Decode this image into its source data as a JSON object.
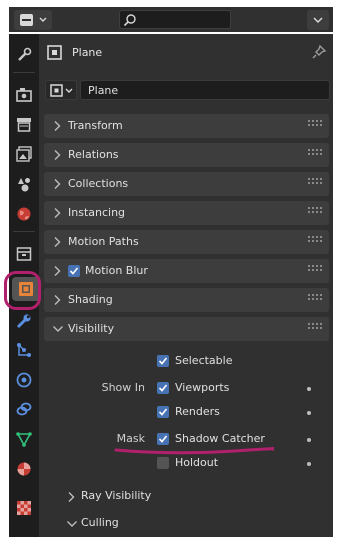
{
  "header": {
    "title": "Plane",
    "name_value": "Plane"
  },
  "sections": [
    {
      "label": "Transform",
      "expanded": false
    },
    {
      "label": "Relations",
      "expanded": false
    },
    {
      "label": "Collections",
      "expanded": false
    },
    {
      "label": "Instancing",
      "expanded": false
    },
    {
      "label": "Motion Paths",
      "expanded": false
    },
    {
      "label": "Motion Blur",
      "expanded": false,
      "checked": true
    },
    {
      "label": "Shading",
      "expanded": false
    },
    {
      "label": "Visibility",
      "expanded": true
    }
  ],
  "visibility": {
    "selectable_label": "Selectable",
    "show_in_label": "Show In",
    "viewports_label": "Viewports",
    "renders_label": "Renders",
    "mask_label": "Mask",
    "shadow_catcher_label": "Shadow Catcher",
    "holdout_label": "Holdout",
    "ray_visibility_label": "Ray Visibility",
    "culling_label": "Culling"
  },
  "tabs": [
    "tool-icon",
    "render-icon",
    "output-icon",
    "view-layer-icon",
    "scene-icon",
    "world-icon",
    "collection-icon",
    "object-icon",
    "modifier-icon",
    "particles-icon",
    "physics-icon",
    "constraints-icon",
    "data-icon",
    "material-icon",
    "texture-icon"
  ],
  "active_tab": "object-icon",
  "colors": {
    "accent": "#4772b3",
    "object_orange": "#e8843a",
    "annotation": "#b0206c"
  }
}
